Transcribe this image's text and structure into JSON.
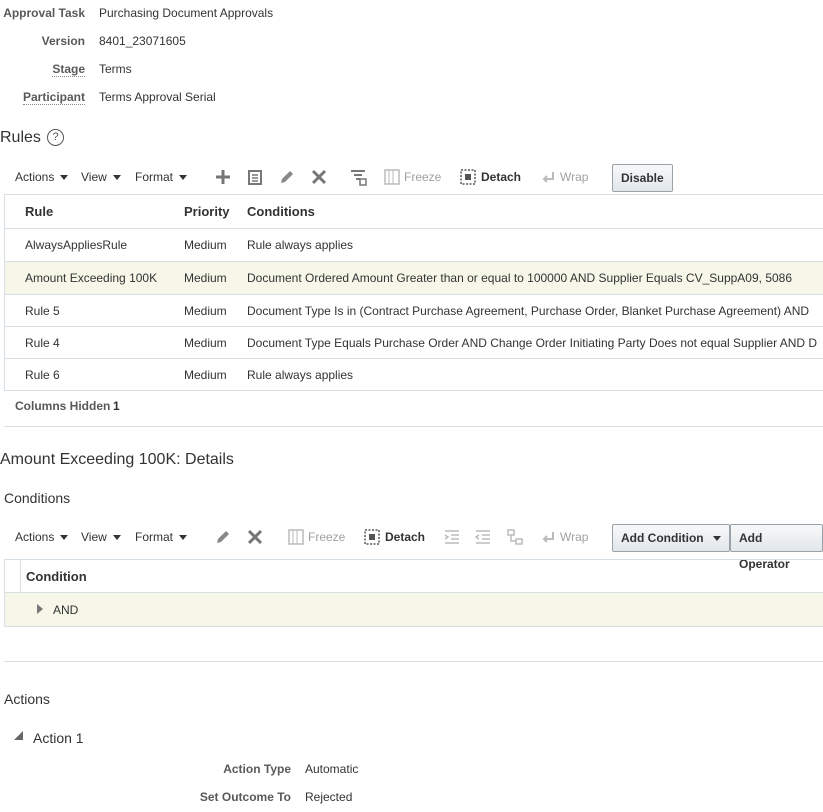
{
  "header": {
    "approval_task_label": "Approval Task",
    "approval_task_value": "Purchasing Document Approvals",
    "version_label": "Version",
    "version_value": "8401_23071605",
    "stage_label": "Stage",
    "stage_value": "Terms",
    "participant_label": "Participant",
    "participant_value": "Terms Approval Serial"
  },
  "rules": {
    "title": "Rules",
    "help_icon": "?",
    "toolbar": {
      "actions": "Actions",
      "view": "View",
      "format": "Format",
      "freeze": "Freeze",
      "detach": "Detach",
      "wrap": "Wrap",
      "disable": "Disable"
    },
    "columns": [
      "Rule",
      "Priority",
      "Conditions"
    ],
    "rows": [
      {
        "rule": "AlwaysAppliesRule",
        "priority": "Medium",
        "conditions": "Rule always applies"
      },
      {
        "rule": "Amount Exceeding 100K",
        "priority": "Medium",
        "conditions": "Document Ordered Amount Greater than or equal to 100000 AND Supplier Equals CV_SuppA09, 5086"
      },
      {
        "rule": "Rule 5",
        "priority": "Medium",
        "conditions": "Document Type Is in (Contract Purchase Agreement, Purchase Order, Blanket Purchase Agreement) AND"
      },
      {
        "rule": "Rule 4",
        "priority": "Medium",
        "conditions": "Document Type Equals Purchase Order AND Change Order Initiating Party Does not equal Supplier AND D"
      },
      {
        "rule": "Rule 6",
        "priority": "Medium",
        "conditions": "Rule always applies"
      }
    ],
    "columns_hidden_label": "Columns Hidden",
    "columns_hidden_count": "1"
  },
  "details": {
    "title": "Amount Exceeding 100K: Details",
    "conditions_title": "Conditions",
    "toolbar": {
      "actions": "Actions",
      "view": "View",
      "format": "Format",
      "freeze": "Freeze",
      "detach": "Detach",
      "wrap": "Wrap",
      "add_condition": "Add Condition",
      "add_operator": "Add Operator"
    },
    "condition_column": "Condition",
    "condition_row": "AND",
    "actions_title": "Actions",
    "action1_title": "Action 1",
    "action_type_label": "Action Type",
    "action_type_value": "Automatic",
    "set_outcome_label": "Set Outcome To",
    "set_outcome_value": "Rejected"
  },
  "colors": {
    "selected_row": "#f6f7e9",
    "border": "#d6dfe6",
    "disabled_text": "#a0a0a0"
  },
  "icons": {
    "add": "plus-icon",
    "duplicate": "duplicate-icon",
    "edit": "pencil-icon",
    "delete": "x-icon",
    "query": "query-by-example-icon",
    "freeze": "freeze-icon",
    "detach": "detach-icon",
    "wrap": "wrap-icon"
  }
}
